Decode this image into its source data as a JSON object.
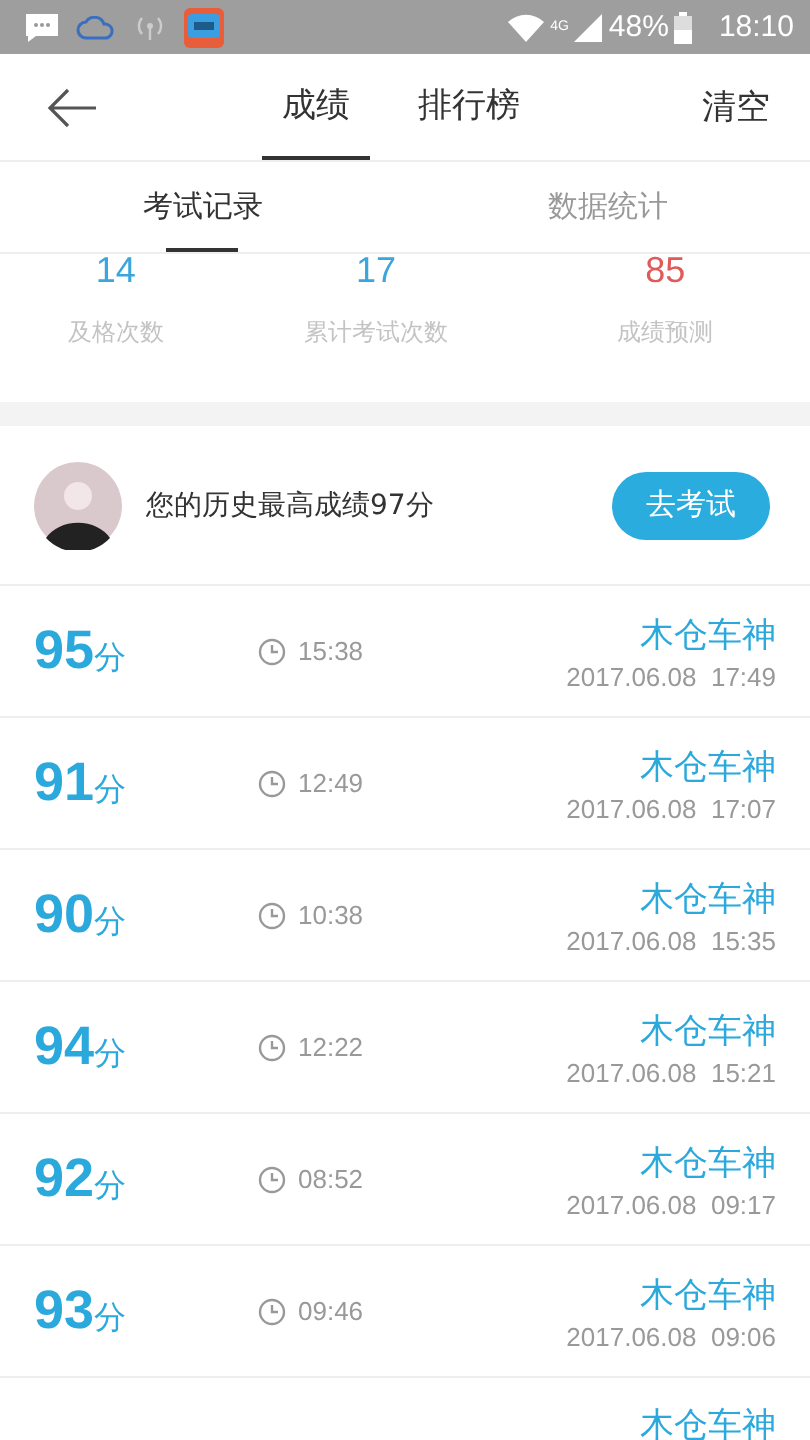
{
  "status_bar": {
    "battery": "48%",
    "time": "18:10",
    "network": "4G"
  },
  "header": {
    "tabs": [
      {
        "label": "成绩",
        "selected": true
      },
      {
        "label": "排行榜",
        "selected": false
      }
    ],
    "action": "清空"
  },
  "sub_tabs": [
    {
      "label": "考试记录",
      "selected": true
    },
    {
      "label": "数据统计",
      "selected": false
    }
  ],
  "stats": [
    {
      "value": "14",
      "label": "及格次数",
      "color": "#3aa6dc"
    },
    {
      "value": "17",
      "label": "累计考试次数",
      "color": "#3aa6dc"
    },
    {
      "value": "85",
      "label": "成绩预测",
      "color": "#e05a5a"
    }
  ],
  "best": {
    "text": "您的历史最高成绩97分",
    "button": "去考试"
  },
  "records": [
    {
      "score": "95",
      "unit": "分",
      "duration": "15:38",
      "name": "木仓车神",
      "date": "2017.06.08  17:49"
    },
    {
      "score": "91",
      "unit": "分",
      "duration": "12:49",
      "name": "木仓车神",
      "date": "2017.06.08  17:07"
    },
    {
      "score": "90",
      "unit": "分",
      "duration": "10:38",
      "name": "木仓车神",
      "date": "2017.06.08  15:35"
    },
    {
      "score": "94",
      "unit": "分",
      "duration": "12:22",
      "name": "木仓车神",
      "date": "2017.06.08  15:21"
    },
    {
      "score": "92",
      "unit": "分",
      "duration": "08:52",
      "name": "木仓车神",
      "date": "2017.06.08  09:17"
    },
    {
      "score": "93",
      "unit": "分",
      "duration": "09:46",
      "name": "木仓车神",
      "date": "2017.06.08  09:06"
    },
    {
      "name": "木仓车神"
    }
  ]
}
